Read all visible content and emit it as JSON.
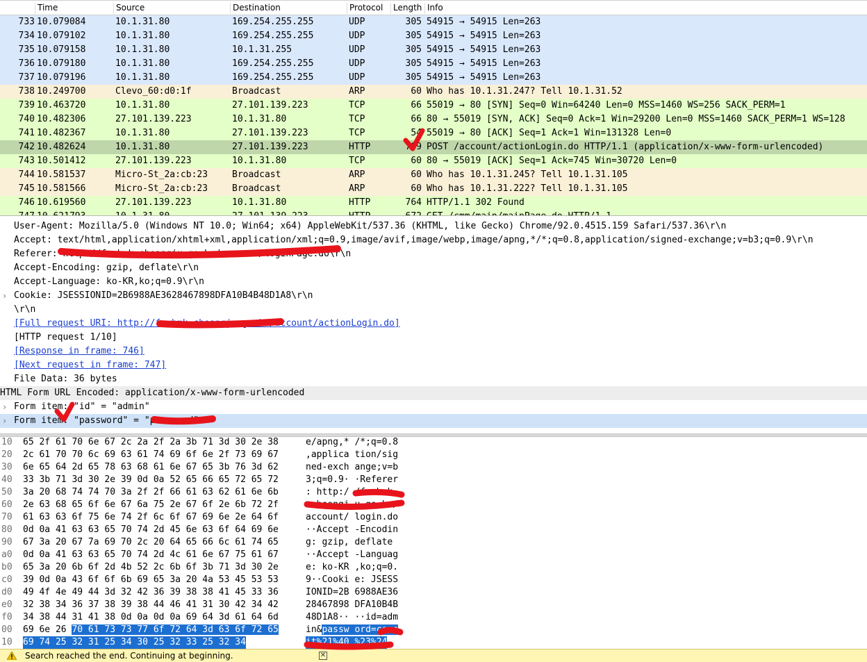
{
  "packet_list": {
    "columns": {
      "no": "",
      "time": "Time",
      "source": "Source",
      "destination": "Destination",
      "protocol": "Protocol",
      "length": "Length",
      "info": "Info"
    },
    "rows": [
      {
        "no": "733",
        "time": "10.079084",
        "src": "10.1.31.80",
        "dst": "169.254.255.255",
        "proto": "UDP",
        "len": "305",
        "info": "54915 → 54915 Len=263",
        "bg": "#dae8fc"
      },
      {
        "no": "734",
        "time": "10.079102",
        "src": "10.1.31.80",
        "dst": "169.254.255.255",
        "proto": "UDP",
        "len": "305",
        "info": "54915 → 54915 Len=263",
        "bg": "#dae8fc"
      },
      {
        "no": "735",
        "time": "10.079158",
        "src": "10.1.31.80",
        "dst": "10.1.31.255",
        "proto": "UDP",
        "len": "305",
        "info": "54915 → 54915 Len=263",
        "bg": "#dae8fc"
      },
      {
        "no": "736",
        "time": "10.079180",
        "src": "10.1.31.80",
        "dst": "169.254.255.255",
        "proto": "UDP",
        "len": "305",
        "info": "54915 → 54915 Len=263",
        "bg": "#dae8fc"
      },
      {
        "no": "737",
        "time": "10.079196",
        "src": "10.1.31.80",
        "dst": "169.254.255.255",
        "proto": "UDP",
        "len": "305",
        "info": "54915 → 54915 Len=263",
        "bg": "#dae8fc"
      },
      {
        "no": "738",
        "time": "10.249700",
        "src": "Clevo_60:d0:1f",
        "dst": "Broadcast",
        "proto": "ARP",
        "len": "60",
        "info": "Who has 10.1.31.247? Tell 10.1.31.52",
        "bg": "#faf0d7"
      },
      {
        "no": "739",
        "time": "10.463720",
        "src": "10.1.31.80",
        "dst": "27.101.139.223",
        "proto": "TCP",
        "len": "66",
        "info": "55019 → 80 [SYN] Seq=0 Win=64240 Len=0 MSS=1460 WS=256 SACK_PERM=1",
        "bg": "#e4ffc7"
      },
      {
        "no": "740",
        "time": "10.482306",
        "src": "27.101.139.223",
        "dst": "10.1.31.80",
        "proto": "TCP",
        "len": "66",
        "info": "80 → 55019 [SYN, ACK] Seq=0 Ack=1 Win=29200 Len=0 MSS=1460 SACK_PERM=1 WS=128",
        "bg": "#e4ffc7"
      },
      {
        "no": "741",
        "time": "10.482367",
        "src": "10.1.31.80",
        "dst": "27.101.139.223",
        "proto": "TCP",
        "len": "54",
        "info": "55019 → 80 [ACK] Seq=1 Ack=1 Win=131328 Len=0",
        "bg": "#e4ffc7"
      },
      {
        "no": "742",
        "time": "10.482624",
        "src": "10.1.31.80",
        "dst": "27.101.139.223",
        "proto": "HTTP",
        "len": "799",
        "info": "POST /account/actionLogin.do HTTP/1.1  (application/x-www-form-urlencoded)",
        "bg": "#bfd6ab"
      },
      {
        "no": "743",
        "time": "10.501412",
        "src": "27.101.139.223",
        "dst": "10.1.31.80",
        "proto": "TCP",
        "len": "60",
        "info": "80 → 55019 [ACK] Seq=1 Ack=745 Win=30720 Len=0",
        "bg": "#e4ffc7"
      },
      {
        "no": "744",
        "time": "10.581537",
        "src": "Micro-St_2a:cb:23",
        "dst": "Broadcast",
        "proto": "ARP",
        "len": "60",
        "info": "Who has 10.1.31.245? Tell 10.1.31.105",
        "bg": "#faf0d7"
      },
      {
        "no": "745",
        "time": "10.581566",
        "src": "Micro-St_2a:cb:23",
        "dst": "Broadcast",
        "proto": "ARP",
        "len": "60",
        "info": "Who has 10.1.31.222? Tell 10.1.31.105",
        "bg": "#faf0d7"
      },
      {
        "no": "746",
        "time": "10.619560",
        "src": "27.101.139.223",
        "dst": "10.1.31.80",
        "proto": "HTTP",
        "len": "764",
        "info": "HTTP/1.1 302 Found",
        "bg": "#e4ffc7"
      },
      {
        "no": "747",
        "time": "10.621793",
        "src": "10.1.31.80",
        "dst": "27.101.139.223",
        "proto": "HTTP",
        "len": "672",
        "info": "GET /cmm/main/mainPage.do HTTP/1.1",
        "bg": "#e4ffc7"
      }
    ]
  },
  "details": {
    "lines": [
      {
        "text": "User-Agent: Mozilla/5.0 (Windows NT 10.0; Win64; x64) AppleWebKit/537.36 (KHTML, like Gecko) Chrome/92.0.4515.159 Safari/537.36\\r\\n",
        "indent": 20,
        "exp": "",
        "style": ""
      },
      {
        "text": "Accept: text/html,application/xhtml+xml,application/xml;q=0.9,image/avif,image/webp,image/apng,*/*;q=0.8,application/signed-exchange;v=b3;q=0.9\\r\\n",
        "indent": 20,
        "exp": "",
        "style": ""
      },
      {
        "text": "Referer: http://fmwhmk.cheangju.go.kr/account/loginPage.do\\r\\n",
        "indent": 20,
        "exp": "",
        "style": ""
      },
      {
        "text": "Accept-Encoding: gzip, deflate\\r\\n",
        "indent": 20,
        "exp": "",
        "style": ""
      },
      {
        "text": "Accept-Language: ko-KR,ko;q=0.9\\r\\n",
        "indent": 20,
        "exp": "",
        "style": ""
      },
      {
        "text": "Cookie: JSESSIONID=2B6988AE3628467898DFA10B4B48D1A8\\r\\n",
        "indent": 20,
        "exp": "›",
        "style": ""
      },
      {
        "text": "\\r\\n",
        "indent": 20,
        "exp": "",
        "style": ""
      },
      {
        "text": "[Full request URI: http://fmwhmk.cheangju.go.kr/account/actionLogin.do]",
        "indent": 20,
        "exp": "",
        "style": "link"
      },
      {
        "text": "[HTTP request 1/10]",
        "indent": 20,
        "exp": "",
        "style": ""
      },
      {
        "text": "[Response in frame: 746]",
        "indent": 20,
        "exp": "",
        "style": "link"
      },
      {
        "text": "[Next request in frame: 747]",
        "indent": 20,
        "exp": "",
        "style": "link"
      },
      {
        "text": "File Data: 36 bytes",
        "indent": 20,
        "exp": "",
        "style": ""
      },
      {
        "text": "HTML Form URL Encoded: application/x-www-form-urlencoded",
        "indent": 0,
        "exp": "",
        "style": "band"
      },
      {
        "text": "Form item: \"id\" = \"admin\"",
        "indent": 20,
        "exp": "›",
        "style": ""
      },
      {
        "text": "Form item: \"password\" = \"password\"",
        "indent": 20,
        "exp": "›",
        "style": "hl"
      }
    ]
  },
  "bytes": {
    "rows": [
      {
        "off": "10",
        "hex": "65 2f 61 70 6e 67 2c 2a  2f 2a 3b 71 3d 30 2e 38",
        "ascii": "e/apng,* /*;q=0.8"
      },
      {
        "off": "20",
        "hex": "2c 61 70 70 6c 69 63 61  74 69 6f 6e 2f 73 69 67",
        "ascii": ",applica tion/sig"
      },
      {
        "off": "30",
        "hex": "6e 65 64 2d 65 78 63 68  61 6e 67 65 3b 76 3d 62",
        "ascii": "ned-exch ange;v=b"
      },
      {
        "off": "40",
        "hex": "33 3b 71 3d 30 2e 39 0d  0a 52 65 66 65 72 65 72",
        "ascii": "3;q=0.9· ·Referer"
      },
      {
        "off": "50",
        "hex": "3a 20 68 74 74 70 3a 2f  2f 66 61 63 62 61 6e 6b",
        "ascii": ": http:/ /fmwhmk."
      },
      {
        "off": "60",
        "hex": "2e 63 68 65 6f 6e 67 6a  75 2e 67 6f 2e 6b 72 2f",
        "ascii": ".cheongj u.go.kr/"
      },
      {
        "off": "70",
        "hex": "61 63 63 6f 75 6e 74 2f  6c 6f 67 69 6e 2e 64 6f",
        "ascii": "account/ login.do"
      },
      {
        "off": "80",
        "hex": "0d 0a 41 63 63 65 70 74  2d 45 6e 63 6f 64 69 6e",
        "ascii": "··Accept -Encodin"
      },
      {
        "off": "90",
        "hex": "67 3a 20 67 7a 69 70 2c  20 64 65 66 6c 61 74 65",
        "ascii": "g: gzip,  deflate"
      },
      {
        "off": "a0",
        "hex": "0d 0a 41 63 63 65 70 74  2d 4c 61 6e 67 75 61 67",
        "ascii": "··Accept -Languag"
      },
      {
        "off": "b0",
        "hex": "65 3a 20 6b 6f 2d 4b 52  2c 6b 6f 3b 71 3d 30 2e",
        "ascii": "e: ko-KR ,ko;q=0."
      },
      {
        "off": "c0",
        "hex": "39 0d 0a 43 6f 6f 6b 69  65 3a 20 4a 53 45 53 53",
        "ascii": "9··Cooki e: JSESS"
      },
      {
        "off": "d0",
        "hex": "49 4f 4e 49 44 3d 32 42  36 39 38 38 41 45 33 36",
        "ascii": "IONID=2B 6988AE36"
      },
      {
        "off": "e0",
        "hex": "32 38 34 36 37 38 39 38  44 46 41 31 30 42 34 42",
        "ascii": "28467898 DFA10B4B"
      },
      {
        "off": "f0",
        "hex": "34 38 44 31 41 38 0d 0a  0d 0a 69 64 3d 61 64 6d",
        "ascii": "48D1A8·· ··id=adm"
      }
    ],
    "row_100": {
      "off": "00",
      "hex_plain": "69 6e 26 ",
      "hex_sel": "70 61 73 73 77  6f 72 64 3d 63 6f 72 65",
      "ascii_plain": "in&",
      "ascii_sel": "passw ord=core"
    },
    "row_110": {
      "off": "10",
      "hex_sel": "69 74 25 32 31 25 34 30  25 32 33 25 32 34",
      "ascii_sel": "it%21%40 %23%24"
    }
  },
  "status": {
    "message": "Search reached the end. Continuing at beginning."
  }
}
